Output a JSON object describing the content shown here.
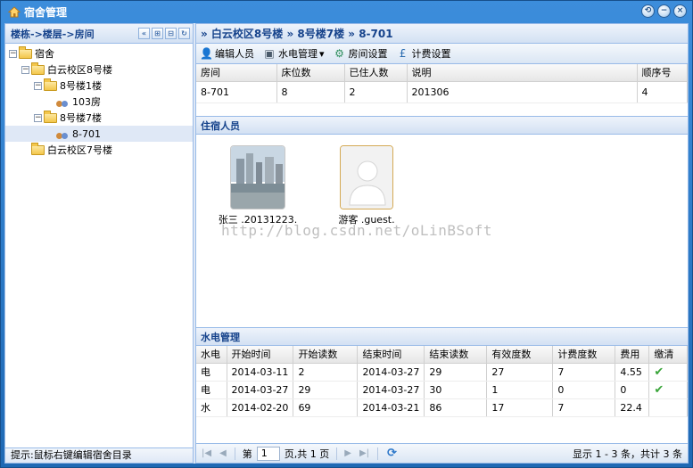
{
  "window": {
    "title": "宿舍管理",
    "buttons": [
      "⟲",
      "−",
      "×"
    ]
  },
  "left": {
    "header": "楼栋->楼层->房间",
    "tools": [
      "«",
      "⊞",
      "⊟",
      "↻"
    ],
    "tree": [
      {
        "label": "宿舍",
        "level": 0,
        "type": "folder",
        "expanded": true
      },
      {
        "label": "白云校区8号楼",
        "level": 1,
        "type": "folder",
        "expanded": true
      },
      {
        "label": "8号楼1楼",
        "level": 2,
        "type": "folder",
        "expanded": true
      },
      {
        "label": "103房",
        "level": 3,
        "type": "room"
      },
      {
        "label": "8号楼7楼",
        "level": 2,
        "type": "folder",
        "expanded": true
      },
      {
        "label": "8-701",
        "level": 3,
        "type": "room",
        "selected": true
      },
      {
        "label": "白云校区7号楼",
        "level": 1,
        "type": "folder"
      }
    ],
    "status": "提示:鼠标右键编辑宿舍目录"
  },
  "right": {
    "breadcrumb": "» 白云校区8号楼 » 8号楼7楼 » 8-701",
    "toolbar": [
      {
        "label": "编辑人员",
        "icon": "person-edit-icon",
        "glyph": "👤"
      },
      {
        "label": "水电管理",
        "icon": "monitor-icon",
        "glyph": "▣",
        "dropdown": "▾"
      },
      {
        "label": "房间设置",
        "icon": "room-settings-icon",
        "glyph": "⚙"
      },
      {
        "label": "计费设置",
        "icon": "currency-icon",
        "glyph": "£"
      }
    ],
    "room_table": {
      "headers": [
        "房间",
        "床位数",
        "已住人数",
        "说明",
        "顺序号"
      ],
      "rows": [
        [
          "8-701",
          "8",
          "2",
          "201306",
          "4"
        ]
      ]
    },
    "residents": {
      "title": "住宿人员",
      "people": [
        {
          "name": "张三 .20131223.",
          "photo": "city-photo"
        },
        {
          "name": "游客 .guest.",
          "photo": "default-avatar"
        }
      ],
      "watermark": "http://blog.csdn.net/oLinBSoft"
    },
    "utilities": {
      "title": "水电管理",
      "headers": [
        "水电",
        "开始时间",
        "开始读数",
        "结束时间",
        "结束读数",
        "有效度数",
        "计费度数",
        "费用",
        "缴清"
      ],
      "rows": [
        [
          "电",
          "2014-03-11",
          "2",
          "2014-03-27",
          "29",
          "27",
          "7",
          "4.55",
          "✔"
        ],
        [
          "电",
          "2014-03-27",
          "29",
          "2014-03-27",
          "30",
          "1",
          "0",
          "0",
          "✔"
        ],
        [
          "水",
          "2014-02-20",
          "69",
          "2014-03-21",
          "86",
          "17",
          "7",
          "22.4",
          ""
        ]
      ]
    },
    "pager": {
      "first": "|◀",
      "prev": "◀",
      "page_label": "第",
      "page_value": "1",
      "page_total": "页,共 1 页",
      "next": "▶",
      "last": "▶|",
      "refresh": "⟳",
      "info": "显示 1 - 3 条，共计 3 条"
    }
  }
}
